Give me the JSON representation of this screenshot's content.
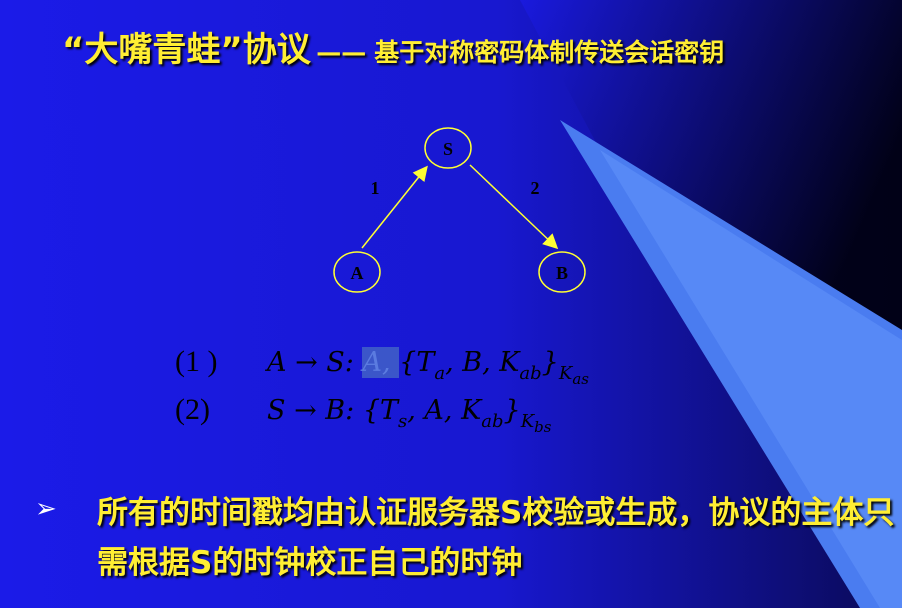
{
  "title": {
    "main": "“大嘴青蛙”协议",
    "dash": "——",
    "sub": "基于对称密码体制传送会话密钥"
  },
  "diagram": {
    "nodes": {
      "s": "S",
      "a": "A",
      "b": "B"
    },
    "edges": {
      "e1": "1",
      "e2": "2"
    },
    "colors": {
      "arrow": "#ffff33",
      "node_stroke": "#ffff33"
    }
  },
  "formulas": [
    {
      "num": "(1 )",
      "lhs": "A → S: ",
      "hl": "A, ",
      "body": "{T",
      "s1": "a",
      "mid": ", B, K",
      "s2": "ab",
      "close": "}",
      "s3": "K",
      "s3b": "as"
    },
    {
      "num": "(2)",
      "lhs": "S → B: ",
      "body": "{T",
      "s1": "s",
      "mid": ", A, K",
      "s2": "ab",
      "close": "}",
      "s3": "K",
      "s3b": "bs"
    }
  ],
  "bullet": {
    "icon": "arrow-bullet-icon",
    "marker": "➢",
    "text": "所有的时间戳均由认证服务器S校验或生成，协议的主体只需根据S的时钟校正自己的时钟"
  },
  "colors": {
    "background": "#1a1ae6",
    "title": "#ffee33",
    "text": "#000000"
  }
}
